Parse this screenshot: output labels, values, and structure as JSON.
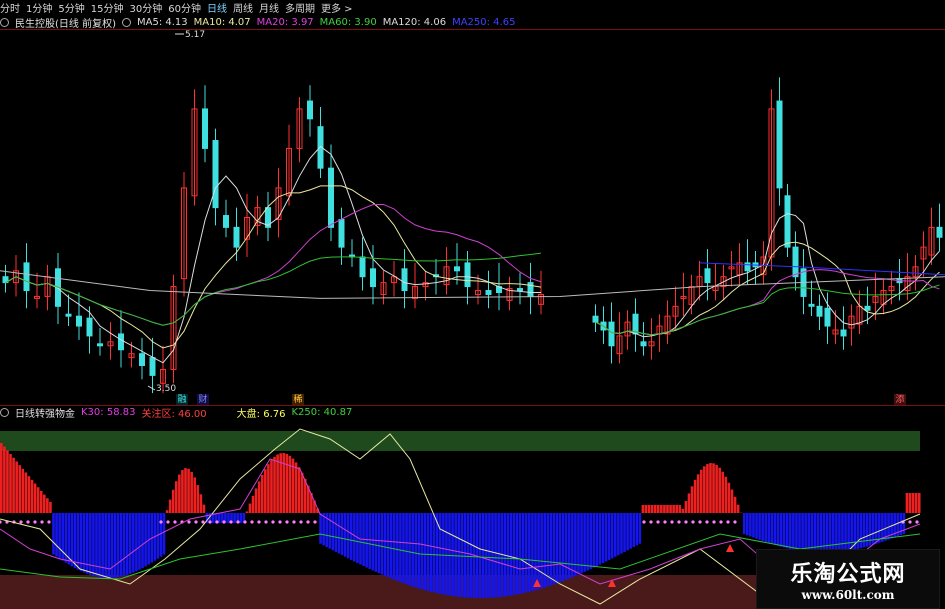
{
  "toolbar": {
    "periods": [
      "分时",
      "1分钟",
      "5分钟",
      "15分钟",
      "30分钟",
      "60分钟",
      "日线",
      "周线",
      "月线",
      "多周期",
      "更多 >"
    ],
    "active": "日线"
  },
  "main_legend": {
    "title": "民生控股(日线 前复权)",
    "items": [
      {
        "text": "MA5: 4.13",
        "color": "#dcdcdc"
      },
      {
        "text": "MA10: 4.07",
        "color": "#e8e8a0"
      },
      {
        "text": "MA20: 3.97",
        "color": "#e040e0"
      },
      {
        "text": "MA60: 3.90",
        "color": "#40d040"
      },
      {
        "text": "MA120: 4.06",
        "color": "#dcdcdc"
      },
      {
        "text": "MA250: 4.65",
        "color": "#4040ff"
      }
    ]
  },
  "price_labels": {
    "high": "5.17",
    "low": "3.50"
  },
  "event_markers": [
    {
      "text": "融",
      "color": "#40e0e0",
      "bg": "#003030"
    },
    {
      "text": "财",
      "color": "#8080ff",
      "bg": "#101040"
    },
    {
      "text": "稀",
      "color": "#ffd040",
      "bg": "#402000"
    },
    {
      "text": "添",
      "color": "#ff6060",
      "bg": "#401010"
    }
  ],
  "indicator_legend": {
    "title": "日线转强物金",
    "items": [
      {
        "text": "K30: 58.83",
        "color": "#e040e0"
      },
      {
        "text": "关注区: 46.00",
        "color": "#ff4040"
      },
      {
        "text": "大盘: 6.76",
        "color": "#ffff60"
      },
      {
        "text": "K250: 40.87",
        "color": "#40d040"
      }
    ]
  },
  "watermark": {
    "title": "乐淘公式网",
    "url": "www.60lt.com"
  },
  "colors": {
    "up": "#ff3030",
    "down": "#40e0e0",
    "zone_top": "#1e4a1e",
    "zone_bottom": "#4a1a1a",
    "pos_bar": "#ee2020",
    "neg_bar": "#1515ee"
  },
  "chart_data": {
    "type": "candlestick",
    "series": [
      {
        "values": [
          4.02,
          4.08,
          3.98,
          3.95,
          4.05,
          3.9,
          3.85,
          3.8,
          3.75,
          3.7,
          3.72,
          3.68,
          3.66,
          3.6,
          3.55,
          3.58,
          4.0,
          4.5,
          4.9,
          4.7,
          4.4,
          4.3,
          4.2,
          4.35,
          4.4,
          4.3,
          4.5,
          4.7,
          4.9,
          4.85,
          4.6,
          4.3,
          4.2,
          4.15,
          4.05,
          4.0,
          4.02,
          4.05,
          3.98,
          4.0,
          4.02,
          4.05,
          4.1,
          4.08,
          4.0,
          3.98,
          3.96,
          3.97,
          3.99,
          3.98,
          3.95,
          3.96
        ]
      },
      {
        "values": [
          3.82,
          3.78,
          3.7,
          3.75,
          3.82,
          3.76,
          3.7,
          3.72,
          3.8,
          3.85,
          3.9,
          3.95,
          4.0,
          4.05,
          4.02,
          4.0,
          4.05,
          4.1,
          4.12,
          4.08,
          4.1,
          4.15,
          4.9,
          4.5,
          4.2,
          4.05,
          3.95,
          3.9,
          3.85,
          3.8,
          3.78,
          3.75,
          3.85,
          3.9,
          3.88,
          3.95,
          3.98,
          4.0,
          4.02,
          4.05,
          4.1,
          4.2,
          4.3,
          4.25
        ]
      }
    ]
  }
}
